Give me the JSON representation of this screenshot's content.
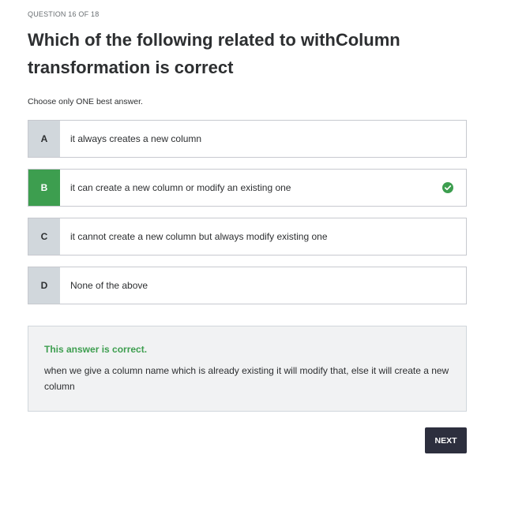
{
  "quiz": {
    "counter": "QUESTION 16 OF 18",
    "question": "Which of the following related to withColumn transformation is correct",
    "instructions": "Choose only ONE best answer.",
    "options": [
      {
        "letter": "A",
        "text": "it always creates a new column",
        "selected": false
      },
      {
        "letter": "B",
        "text": "it can create a new column or modify an existing one",
        "selected": true
      },
      {
        "letter": "C",
        "text": "it cannot create a new column but always modify existing one",
        "selected": false
      },
      {
        "letter": "D",
        "text": "None of the above",
        "selected": false
      }
    ],
    "selected_icon": "check-circle-icon"
  },
  "feedback": {
    "verdict": "This answer is correct.",
    "explanation": "when we give a column name which is already existing it will modify that, else it will create a new column"
  },
  "actions": {
    "next_label": "NEXT"
  },
  "colors": {
    "correct": "#3d9e4f",
    "button": "#2d2f3e",
    "letter_bg": "#d1d7dc",
    "feedback_bg": "#f1f2f3"
  }
}
